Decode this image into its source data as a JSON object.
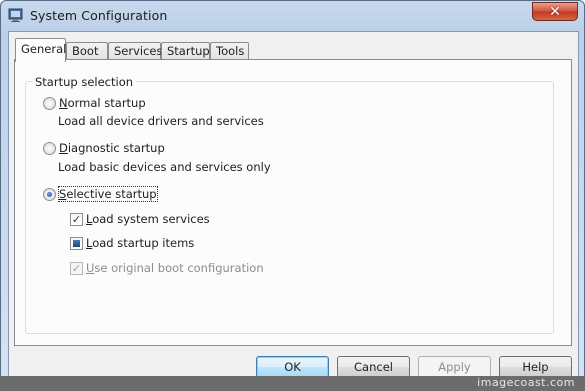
{
  "window": {
    "title": "System Configuration",
    "app_icon": "msconfig-icon",
    "close_label": "✕"
  },
  "tabs": [
    {
      "label": "General",
      "active": true
    },
    {
      "label": "Boot",
      "active": false
    },
    {
      "label": "Services",
      "active": false
    },
    {
      "label": "Startup",
      "active": false
    },
    {
      "label": "Tools",
      "active": false
    }
  ],
  "startup_selection": {
    "group_label": "Startup selection",
    "normal": {
      "label": "Normal startup",
      "mnemonic": "N",
      "description": "Load all device drivers and services",
      "selected": false
    },
    "diagnostic": {
      "label": "Diagnostic startup",
      "mnemonic": "D",
      "description": "Load basic devices and services only",
      "selected": false
    },
    "selective": {
      "label": "Selective startup",
      "mnemonic": "S",
      "selected": true,
      "load_system_services": {
        "label": "Load system services",
        "mnemonic": "L",
        "state": "checked"
      },
      "load_startup_items": {
        "label": "Load startup items",
        "mnemonic": "L",
        "state": "indeterminate"
      },
      "use_original_boot": {
        "label": "Use original boot configuration",
        "mnemonic": "U",
        "state": "checked-disabled"
      }
    }
  },
  "buttons": {
    "ok": "OK",
    "cancel": "Cancel",
    "apply": "Apply",
    "help": "Help"
  },
  "watermark": "imagecoast.com",
  "colors": {
    "accent": "#3c7fb1",
    "close_red": "#c23a22"
  }
}
